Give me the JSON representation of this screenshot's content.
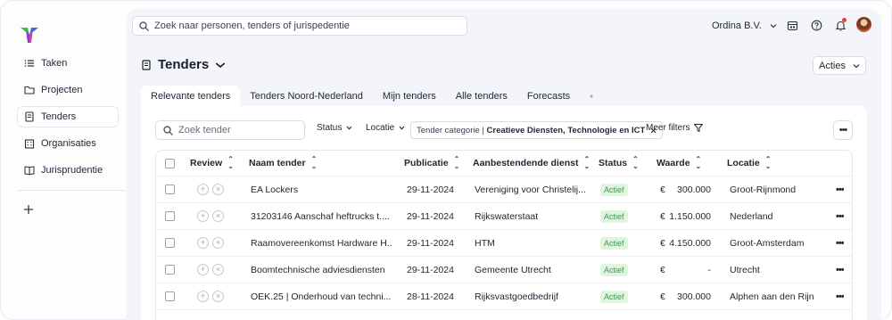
{
  "header": {
    "search_placeholder": "Zoek naar personen, tenders of jurispedentie",
    "org_name": "Ordina B.V."
  },
  "sidebar": {
    "items": [
      {
        "label": "Taken",
        "icon": "list-icon",
        "active": false
      },
      {
        "label": "Projecten",
        "icon": "folder-icon",
        "active": false
      },
      {
        "label": "Tenders",
        "icon": "document-icon",
        "active": true
      },
      {
        "label": "Organisaties",
        "icon": "building-icon",
        "active": false
      },
      {
        "label": "Jurisprudentie",
        "icon": "book-icon",
        "active": false
      }
    ],
    "add_label": "+"
  },
  "page": {
    "title": "Tenders",
    "actions_label": "Acties"
  },
  "tabs": [
    {
      "label": "Relevante tenders",
      "active": true
    },
    {
      "label": "Tenders Noord-Nederland",
      "active": false
    },
    {
      "label": "Mijn tenders",
      "active": false
    },
    {
      "label": "Alle tenders",
      "active": false
    },
    {
      "label": "Forecasts",
      "active": false
    }
  ],
  "filters": {
    "search_placeholder": "Zoek tender",
    "status_label": "Status",
    "locatie_label": "Locatie",
    "chip_prefix": "Tender categorie |",
    "chip_value": "Creatieve Diensten, Technologie en ICT",
    "more_filters_label": "Meer filters"
  },
  "table": {
    "columns": [
      "Review",
      "Naam tender",
      "Publicatie",
      "Aanbestendende dienst",
      "Status",
      "Waarde",
      "Locatie"
    ],
    "currency": "€",
    "rows": [
      {
        "name": "EA Lockers",
        "date": "29-11-2024",
        "agency": "Vereniging voor Christelij...",
        "status": "Actief",
        "value": "300.000",
        "location": "Groot-Rijnmond"
      },
      {
        "name": "31203146 Aanschaf heftrucks t....",
        "date": "29-11-2024",
        "agency": "Rijkswaterstaat",
        "status": "Actief",
        "value": "1.150.000",
        "location": "Nederland"
      },
      {
        "name": "Raamovereenkomst Hardware H...",
        "date": "29-11-2024",
        "agency": "HTM",
        "status": "Actief",
        "value": "4.150.000",
        "location": "Groot-Amsterdam"
      },
      {
        "name": "Boomtechnische adviesdiensten",
        "date": "29-11-2024",
        "agency": "Gemeente Utrecht",
        "status": "Actief",
        "value": "-",
        "location": "Utrecht"
      },
      {
        "name": "OEK.25 | Onderhoud van techni...",
        "date": "28-11-2024",
        "agency": "Rijksvastgoedbedrijf",
        "status": "Actief",
        "value": "300.000",
        "location": "Alphen aan den Rijn"
      }
    ]
  },
  "colors": {
    "accent_green": "#3e9b45",
    "badge_bg": "#dff5df",
    "notification": "#e23b4a"
  }
}
